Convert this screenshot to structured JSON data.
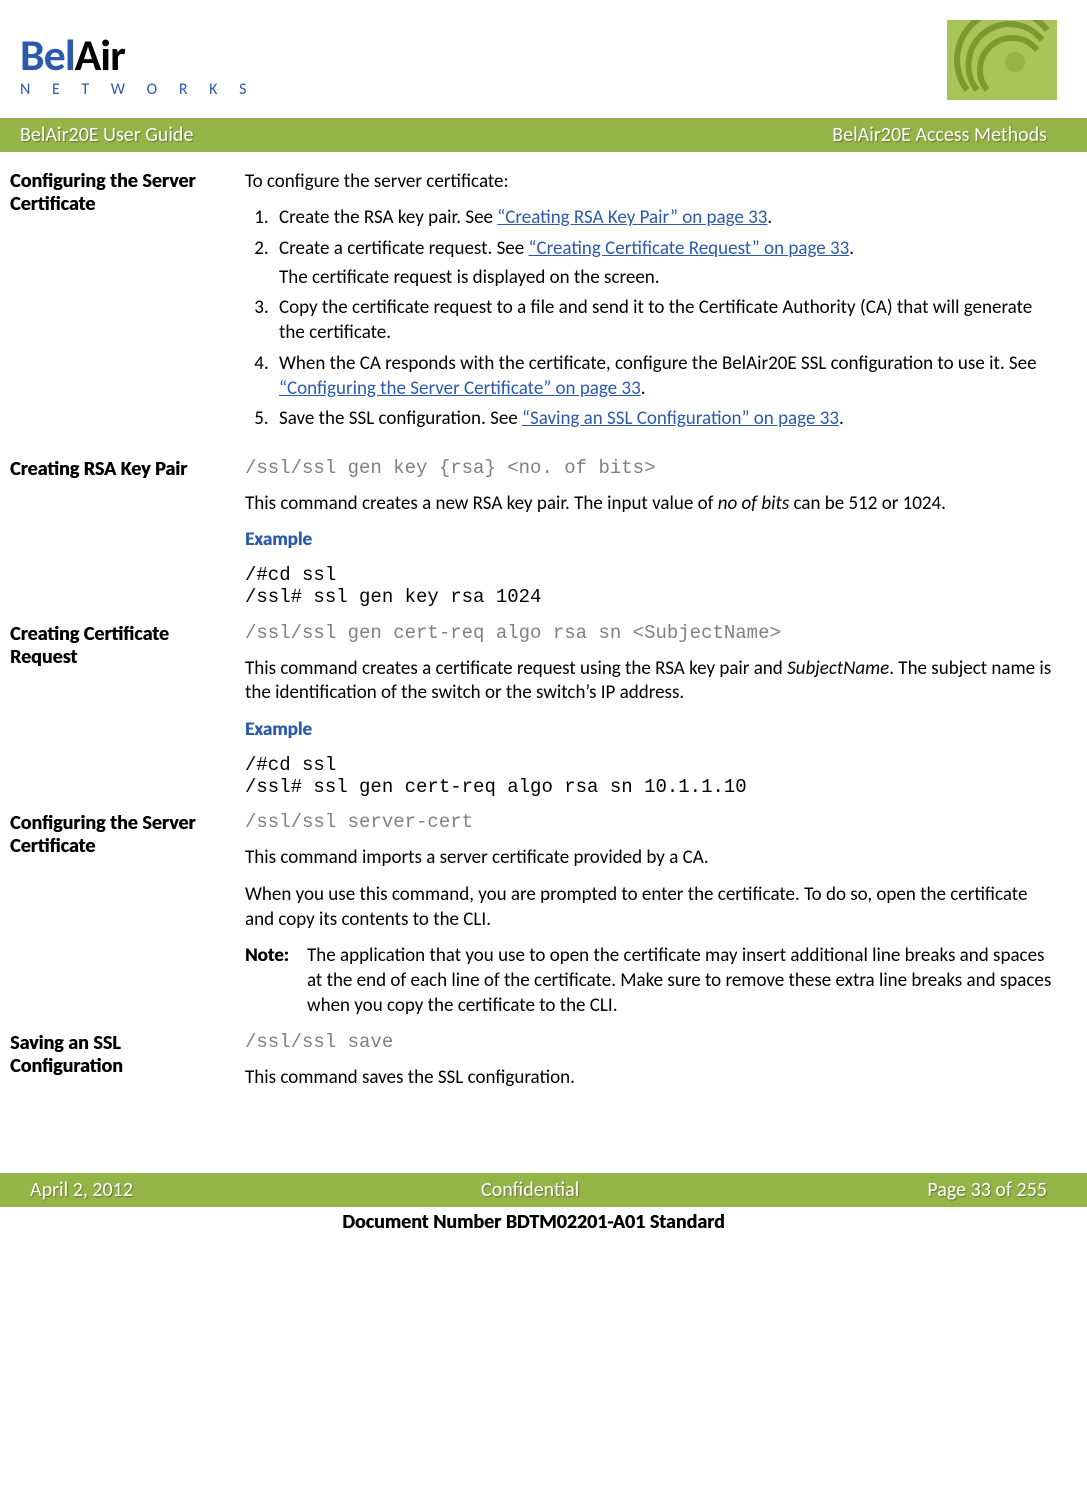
{
  "header": {
    "brand_left": "Bel",
    "brand_right": "Air",
    "brand_sub": "N E T W O R K S",
    "title_left": "BelAir20E User Guide",
    "title_right": "BelAir20E Access Methods"
  },
  "sections": {
    "s1_heading": "Configuring the Server Certificate",
    "s1_intro": "To configure the server certificate:",
    "s1_step1a": "Create the RSA key pair. See ",
    "s1_step1_link": "“Creating RSA Key Pair” on page 33",
    "s1_step1b": ".",
    "s1_step2a": "Create a certificate request. See ",
    "s1_step2_link": "“Creating Certificate Request” on page 33",
    "s1_step2b": ".",
    "s1_step2c": "The certificate request is displayed on the screen.",
    "s1_step3": "Copy the certificate request to a file and send it to the Certificate Authority (CA) that will generate the certificate.",
    "s1_step4a": "When the CA responds with the certificate, configure the BelAir20E SSL configuration to use it. See ",
    "s1_step4_link": "“Configuring the Server Certificate” on page 33",
    "s1_step4b": ".",
    "s1_step5a": "Save the SSL configuration. See ",
    "s1_step5_link": "“Saving an SSL Configuration” on page 33",
    "s1_step5b": ".",
    "s2_heading": "Creating RSA Key Pair",
    "s2_cmd": "/ssl/ssl gen key {rsa} <no. of bits>",
    "s2_desc1": "This command creates a new RSA key pair. The input value of ",
    "s2_desc_ital": "no of bits",
    "s2_desc2": " can be 512 or 1024.",
    "s2_example_label": "Example",
    "s2_example": "/#cd ssl\n/ssl# ssl gen key rsa 1024",
    "s3_heading": "Creating Certificate Request",
    "s3_cmd": "/ssl/ssl gen cert-req algo rsa sn <SubjectName>",
    "s3_desc1": "This command creates a certificate request using the RSA key pair and ",
    "s3_desc_ital": "SubjectName",
    "s3_desc2": ". The subject name is the identification of the switch or the switch’s IP address.",
    "s3_example_label": "Example",
    "s3_example": "/#cd ssl\n/ssl# ssl gen cert-req algo rsa sn 10.1.1.10",
    "s4_heading": "Configuring the Server Certificate",
    "s4_cmd": "/ssl/ssl server-cert",
    "s4_desc1": "This command imports a server certificate provided by a CA.",
    "s4_desc2": "When you use this command, you are prompted to enter the certificate. To do so, open the certificate and copy its contents to the CLI.",
    "s4_note_label": "Note:",
    "s4_note": "The application that you use to open the certificate may insert additional line breaks and spaces at the end of each line of the certificate. Make sure to remove these extra line breaks and spaces when you copy the certificate to the CLI.",
    "s5_heading": "Saving an SSL Configuration",
    "s5_cmd": "/ssl/ssl save",
    "s5_desc": "This command saves the SSL configuration."
  },
  "footer": {
    "left": "April 2, 2012",
    "center": "Confidential",
    "right": "Page 33 of 255",
    "docnum": "Document Number BDTM02201-A01 Standard"
  }
}
